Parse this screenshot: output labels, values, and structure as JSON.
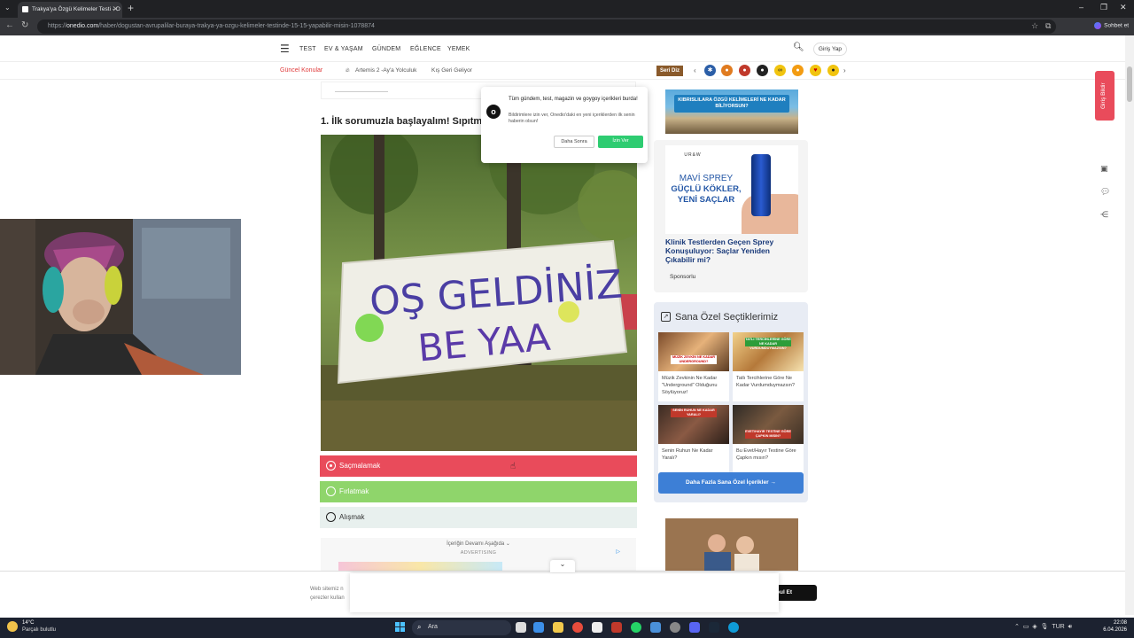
{
  "browser": {
    "tab_title": "Trakya'ya Özgü Kelimeler Testi - O",
    "url_prefix": "https://",
    "url_domain": "onedio.com",
    "url_path": "/haber/dogustan-avrupalilar-buraya-trakya-ya-ozgu-kelimeler-testinde-15-15-yapabilir-misin-1078874",
    "sohbet_label": "Sohbet et"
  },
  "site_nav": {
    "menu_items": [
      "TEST",
      "EV & YAŞAM",
      "GÜNDEM",
      "EĞLENCE",
      "YEMEK"
    ],
    "login_label": "Giriş Yap"
  },
  "topics": {
    "label": "Güncel Konular",
    "items": [
      "Artemis 2 -Ay'a Yolculuk",
      "Kış Geri Geliyor"
    ],
    "seri_diz_label": "Seri Diz"
  },
  "notification": {
    "title": "Tüm gündem, test, magazin ve goygoy içerikleri burda!",
    "body": "Bildirimlere izin ver, Onedio'daki en yeni içeriklerden ilk senin haberin olsun!",
    "later_label": "Daha Sonra",
    "allow_label": "İzin Ver"
  },
  "article": {
    "question": "1. İlk sorumuzla başlayalım! Sıpıtm",
    "banner_line1": "OŞ GELDİNİZ",
    "banner_line2": "BE YAA",
    "answers": [
      {
        "label": "Saçmalamak",
        "state": "wrong-selected"
      },
      {
        "label": "Fırlatmak",
        "state": "correct"
      },
      {
        "label": "Alışmak",
        "state": "neutral"
      }
    ],
    "ad_continue": "İçeriğin Devamı Aşağıda ⌄",
    "ad_label": "ADVERTISING"
  },
  "sidebar": {
    "cyprus_banner": "KIBRISLILARA ÖZGÜ KELİMELERİ NE KADAR BİLİYORSUN?",
    "ad": {
      "brand": "UR&W",
      "headline1": "MAVİ SPREY",
      "headline2a": "GÜÇLÜ KÖKLER,",
      "headline2b": "YENİ SAÇLAR",
      "title": "Klinik Testlerden Geçen Sprey Konuşuluyor: Saçlar Yeniden Çıkabilir mi?",
      "sponsor": "Sponsorlu"
    },
    "special": {
      "title": "Sana Özel Seçtiklerimiz",
      "cards": [
        {
          "thumb_label": "MÜZİK ZEVKİN NE KADAR UNDERGROUND?",
          "text": "Müzik Zevkinin Ne Kadar \"Underground\" Olduğunu Söylüyoruz!"
        },
        {
          "thumb_label": "TATLI TERCİHLERİNE GÖRE NE KADAR VURDUMDUYMAZSIN?",
          "text": "Tatlı Tercihlerine Göre Ne Kadar Vurdumduymazsın?"
        },
        {
          "thumb_label": "SENİN RUHUN NE KADAR YARALI?",
          "text": "Senin Ruhun Ne Kadar Yaralı?"
        },
        {
          "thumb_label": "EVET/HAYIR TESTİNE GÖRE ÇAPKIN MISIN?",
          "text": "Bu Evet/Hayır Testine Göre Çapkın mısın?"
        }
      ],
      "more_label": "Daha Fazla Sana Özel İçerikler  →"
    }
  },
  "floating": {
    "giris_bildir": "Giriş Bildir"
  },
  "cookie": {
    "text_line1": "Web sitemiz n",
    "text_line2": "çerezler kullan",
    "accept_label": "bul Et"
  },
  "taskbar": {
    "temp": "14°C",
    "weather": "Parçalı bulutlu",
    "search_placeholder": "Ara",
    "lang": "TUR",
    "time": "22:08",
    "date": "6.04.2026"
  }
}
